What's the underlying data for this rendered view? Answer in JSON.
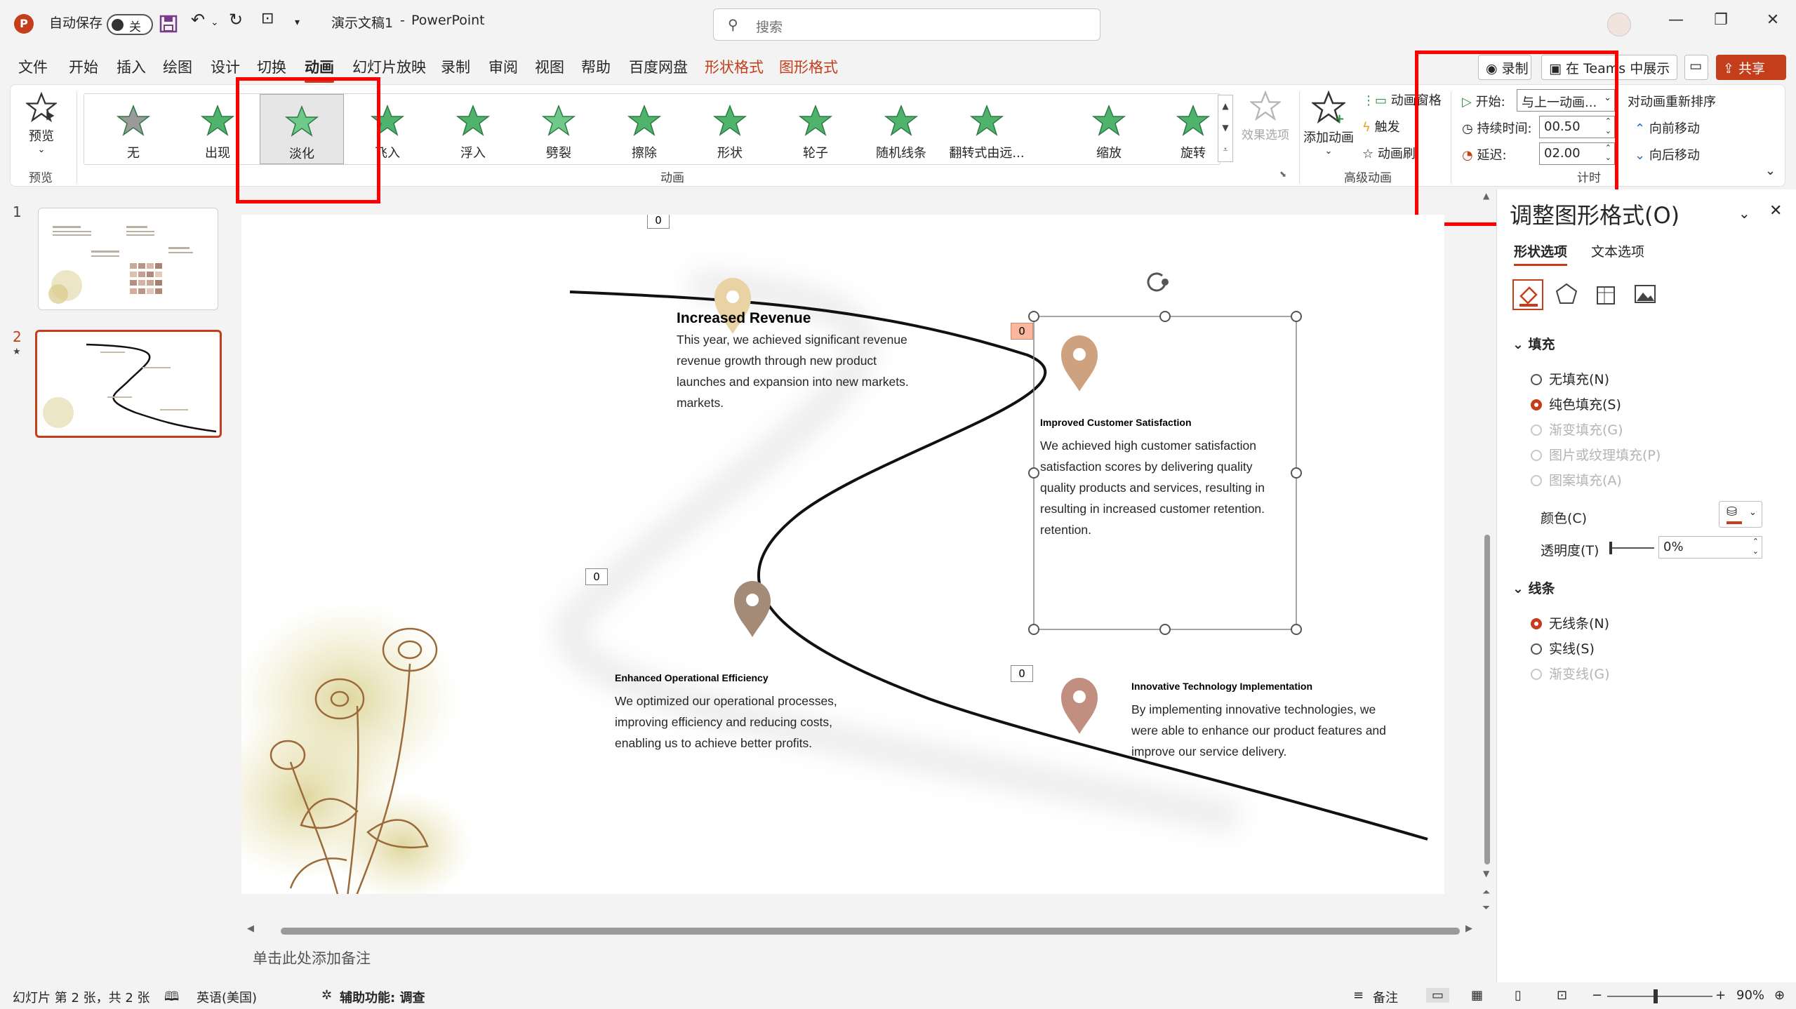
{
  "titlebar": {
    "autosave_label": "自动保存",
    "autosave_state": "关",
    "doc_title": "演示文稿1",
    "separator": "-",
    "app_name": "PowerPoint",
    "search_placeholder": "搜索"
  },
  "menu": {
    "tabs": [
      "文件",
      "开始",
      "插入",
      "绘图",
      "设计",
      "切换",
      "动画",
      "幻灯片放映",
      "录制",
      "审阅",
      "视图",
      "帮助",
      "百度网盘",
      "形状格式",
      "图形格式"
    ],
    "active_tab": "动画",
    "record_label": "录制",
    "teams_label": "在 Teams 中展示",
    "share_label": "共享"
  },
  "ribbon": {
    "preview_label": "预览",
    "preview_group": "预览",
    "animation_group": "动画",
    "animations": [
      {
        "name": "无",
        "color": "#9a9a9a"
      },
      {
        "name": "出现",
        "color": "#4fb36b"
      },
      {
        "name": "淡化",
        "color": "#6fc98a"
      },
      {
        "name": "飞入",
        "color": "#4fb36b"
      },
      {
        "name": "浮入",
        "color": "#4fb36b"
      },
      {
        "name": "劈裂",
        "color": "#6fc98a"
      },
      {
        "name": "擦除",
        "color": "#4fb36b"
      },
      {
        "name": "形状",
        "color": "#4fb36b"
      },
      {
        "name": "轮子",
        "color": "#4fb36b"
      },
      {
        "name": "随机线条",
        "color": "#4fb36b"
      },
      {
        "name": "翻转式由远...",
        "color": "#4fb36b"
      },
      {
        "name": "缩放",
        "color": "#4fb36b"
      },
      {
        "name": "旋转",
        "color": "#4fb36b"
      }
    ],
    "selected_animation": "淡化",
    "effect_options": "效果选项",
    "add_animation": "添加动画",
    "animation_pane": "动画窗格",
    "trigger": "触发",
    "animation_painter": "动画刷",
    "advanced_group": "高级动画",
    "start_label": "开始:",
    "start_value": "与上一动画...",
    "duration_label": "持续时间:",
    "duration_value": "00.50",
    "delay_label": "延迟:",
    "delay_value": "02.00",
    "timing_group": "计时",
    "reorder_label": "对动画重新排序",
    "move_earlier": "向前移动",
    "move_later": "向后移动"
  },
  "thumbnails": [
    {
      "number": "1"
    },
    {
      "number": "2",
      "star": "★"
    }
  ],
  "slide": {
    "tags": [
      "0",
      "0",
      "0",
      "0"
    ],
    "item1": {
      "title": "Increased Revenue",
      "lines": [
        "This year, we achieved significant revenue",
        "revenue growth through new product",
        "launches and expansion into new markets.",
        "markets."
      ]
    },
    "item2": {
      "title": "Improved Customer Satisfaction",
      "lines": [
        "We achieved high customer satisfaction",
        "satisfaction scores by delivering quality",
        "quality products and services, resulting in",
        "resulting in increased customer retention.",
        "retention."
      ]
    },
    "item3": {
      "title": "Enhanced Operational Efficiency",
      "lines": [
        "We optimized our operational processes,",
        "improving efficiency and reducing costs,",
        "enabling us to achieve better profits."
      ]
    },
    "item4": {
      "title": "Innovative Technology Implementation",
      "lines": [
        "By implementing innovative technologies, we",
        "were able to enhance our product features and",
        "improve our service delivery."
      ]
    },
    "pin_colors": [
      "#e9d2a4",
      "#cfa27f",
      "#a38b78",
      "#c28e80"
    ]
  },
  "notes_placeholder": "单击此处添加备注",
  "pane": {
    "title": "调整图形格式(O)",
    "tab_shape": "形状选项",
    "tab_text": "文本选项",
    "fill_section": "填充",
    "fill_options": [
      {
        "label": "无填充(N)",
        "state": "off"
      },
      {
        "label": "纯色填充(S)",
        "state": "on"
      },
      {
        "label": "渐变填充(G)",
        "state": "disabled"
      },
      {
        "label": "图片或纹理填充(P)",
        "state": "disabled"
      },
      {
        "label": "图案填充(A)",
        "state": "disabled"
      }
    ],
    "color_label": "颜色(C)",
    "transparency_label": "透明度(T)",
    "transparency_value": "0%",
    "line_section": "线条",
    "line_options": [
      {
        "label": "无线条(N)",
        "state": "on"
      },
      {
        "label": "实线(S)",
        "state": "off"
      },
      {
        "label": "渐变线(G)",
        "state": "disabled"
      }
    ]
  },
  "statusbar": {
    "slide_info": "幻灯片 第 2 张，共 2 张",
    "language": "英语(美国)",
    "accessibility": "辅助功能: 调查",
    "notes": "备注",
    "zoom": "90%"
  },
  "colors": {
    "accent": "#c43e1c",
    "highlight_box": "#ff0000",
    "animation_green": "#4fb36b"
  }
}
